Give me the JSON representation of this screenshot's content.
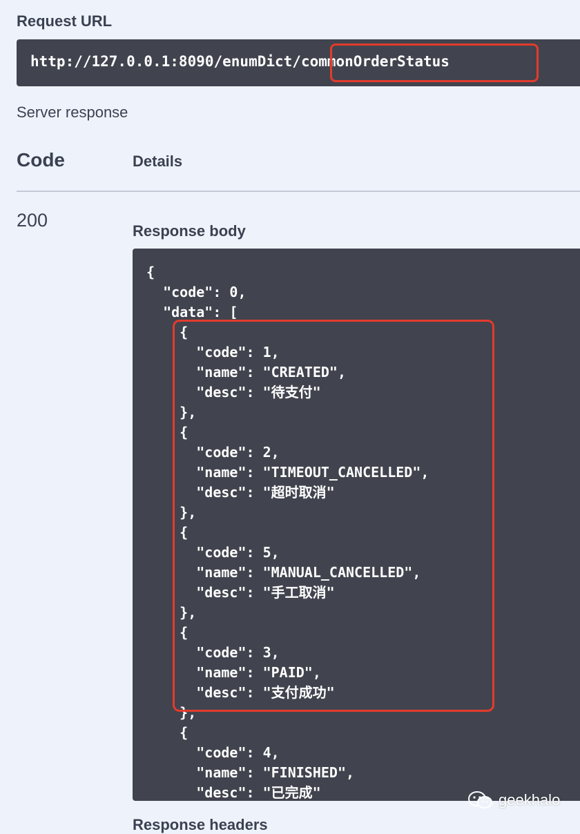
{
  "request_url": {
    "label": "Request URL",
    "prefix": "http://127.0.0.1:8090/enumDict",
    "slash": "/",
    "highlighted_segment": "commonOrderStatus"
  },
  "server_response": {
    "label": "Server response",
    "col_code": "Code",
    "col_details": "Details",
    "status_code": "200",
    "response_body_label": "Response body",
    "response_headers_label": "Response headers"
  },
  "response_body": {
    "code": 0,
    "items": [
      {
        "code": 1,
        "name": "CREATED",
        "desc": "待支付"
      },
      {
        "code": 2,
        "name": "TIMEOUT_CANCELLED",
        "desc": "超时取消"
      },
      {
        "code": 5,
        "name": "MANUAL_CANCELLED",
        "desc": "手工取消"
      },
      {
        "code": 3,
        "name": "PAID",
        "desc": "支付成功"
      },
      {
        "code": 4,
        "name": "FINISHED",
        "desc": "已完成"
      }
    ]
  },
  "watermark": {
    "text": "geekhalo",
    "icon": "wechat-icon"
  },
  "colors": {
    "page_bg": "#eef3fb",
    "code_bg": "#41444e",
    "highlight": "#e33b2c",
    "text": "#3b4151"
  }
}
